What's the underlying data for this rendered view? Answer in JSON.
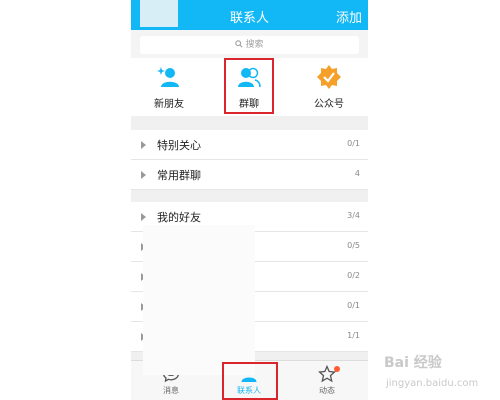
{
  "header": {
    "title": "联系人",
    "action": "添加"
  },
  "search": {
    "placeholder": "搜索"
  },
  "quick": [
    {
      "label": "新朋友",
      "icon": "new-friend-icon"
    },
    {
      "label": "群聊",
      "icon": "group-chat-icon"
    },
    {
      "label": "公众号",
      "icon": "official-account-icon"
    }
  ],
  "groups": [
    {
      "name": "特别关心",
      "count": "0/1"
    },
    {
      "name": "常用群聊",
      "count": "4"
    },
    {
      "name": "我的好友",
      "count": "3/4"
    },
    {
      "name": "",
      "count": "0/5"
    },
    {
      "name": "",
      "count": "0/2"
    },
    {
      "name": "",
      "count": "0/1"
    },
    {
      "name": "",
      "count": "1/1"
    }
  ],
  "tabs": [
    {
      "label": "消息",
      "icon": "message-icon"
    },
    {
      "label": "联系人",
      "icon": "contacts-icon"
    },
    {
      "label": "动态",
      "icon": "star-icon"
    }
  ],
  "watermark": {
    "text": "Bai 经验",
    "url": "jingyan.baidu.com"
  },
  "colors": {
    "accent": "#12b7f5",
    "highlight": "#d9262c",
    "badge": "#ff5a34"
  }
}
